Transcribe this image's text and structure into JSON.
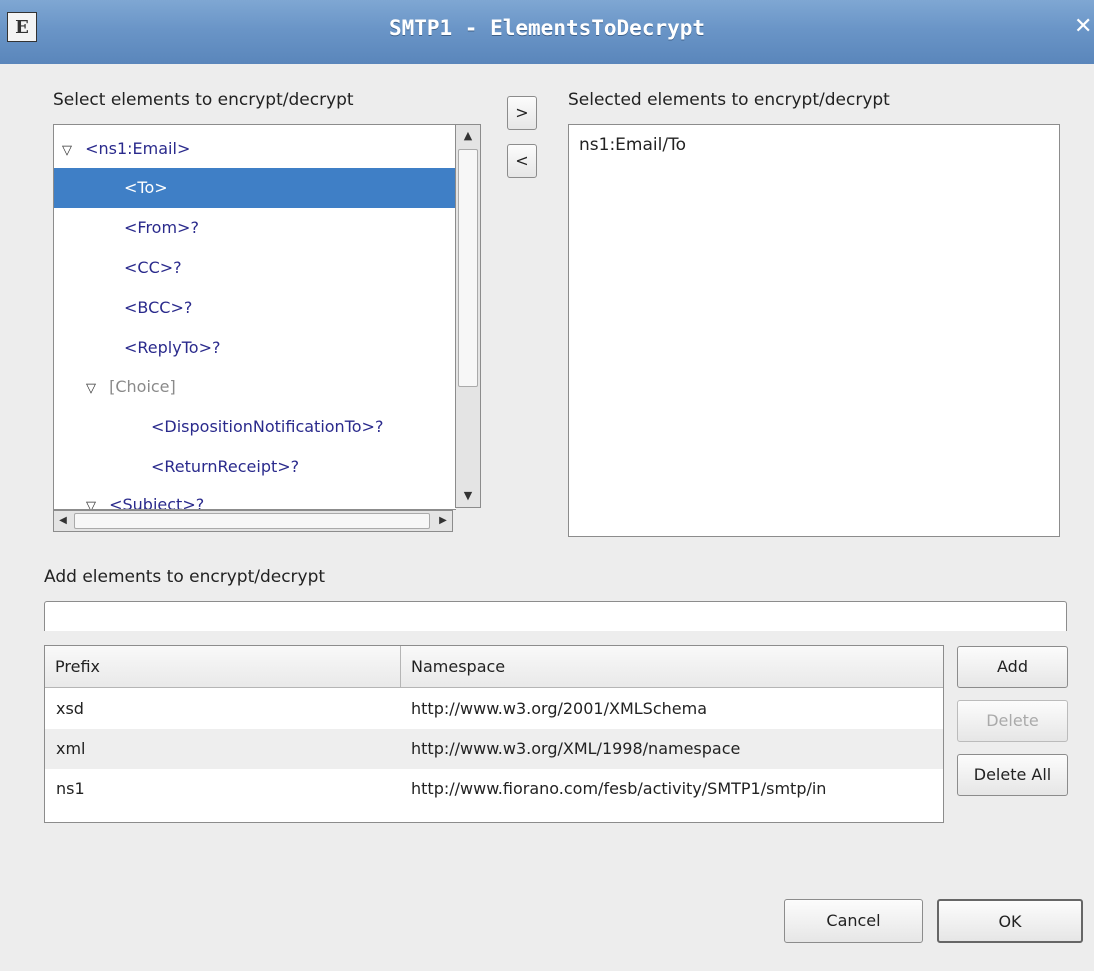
{
  "window": {
    "title": "SMTP1 - ElementsToDecrypt",
    "icon_glyph": "E",
    "close_glyph": "✕"
  },
  "tree_section": {
    "label": "Select elements to encrypt/decrypt",
    "nodes": [
      {
        "label": "<ns1:Email>",
        "twisty": "▽"
      },
      {
        "label": "<To>"
      },
      {
        "label": "<From>?"
      },
      {
        "label": "<CC>?"
      },
      {
        "label": "<BCC>?"
      },
      {
        "label": "<ReplyTo>?"
      },
      {
        "label": "[Choice]",
        "twisty": "▽"
      },
      {
        "label": "<DispositionNotificationTo>?"
      },
      {
        "label": "<ReturnReceipt>?"
      },
      {
        "label": "<Subject>?",
        "twisty": "▽"
      }
    ]
  },
  "move_buttons": {
    "add": ">",
    "remove": "<"
  },
  "selected_section": {
    "label": "Selected elements to encrypt/decrypt",
    "items": [
      "ns1:Email/To"
    ]
  },
  "add_section": {
    "label": "Add elements to encrypt/decrypt",
    "value": ""
  },
  "namespace_table": {
    "headers": {
      "prefix": "Prefix",
      "namespace": "Namespace"
    },
    "rows": [
      {
        "prefix": "xsd",
        "namespace": "http://www.w3.org/2001/XMLSchema"
      },
      {
        "prefix": "xml",
        "namespace": "http://www.w3.org/XML/1998/namespace"
      },
      {
        "prefix": "ns1",
        "namespace": "http://www.fiorano.com/fesb/activity/SMTP1/smtp/in"
      }
    ]
  },
  "table_buttons": {
    "add": "Add",
    "delete": "Delete",
    "delete_all": "Delete All"
  },
  "dialog_buttons": {
    "cancel": "Cancel",
    "ok": "OK"
  },
  "colors": {
    "titlebar": "#6a95c7",
    "selection": "#3f7fc6",
    "tree_text": "#2a2a8c"
  }
}
